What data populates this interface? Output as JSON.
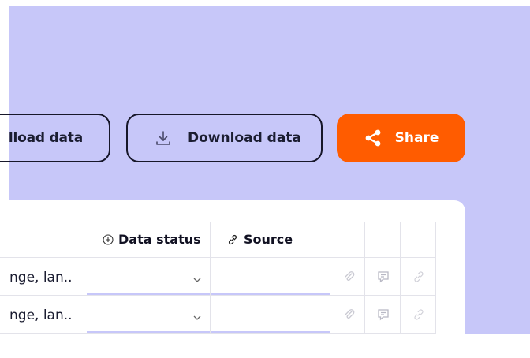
{
  "toolbar": {
    "upload_label": "lload data",
    "download_label": "Download data",
    "share_label": "Share"
  },
  "table": {
    "headers": {
      "data_status": "Data status",
      "source": "Source"
    },
    "rows": [
      {
        "range_text": "nge, lan.."
      },
      {
        "range_text": "nge, lan.."
      }
    ]
  },
  "colors": {
    "background": "#c7c7f9",
    "share_button": "#ff5c00",
    "text": "#1b1d31"
  },
  "icons": [
    "download-icon",
    "share-icon",
    "status-icon",
    "link-icon",
    "chevron-down-icon",
    "attachment-icon",
    "comment-icon"
  ]
}
